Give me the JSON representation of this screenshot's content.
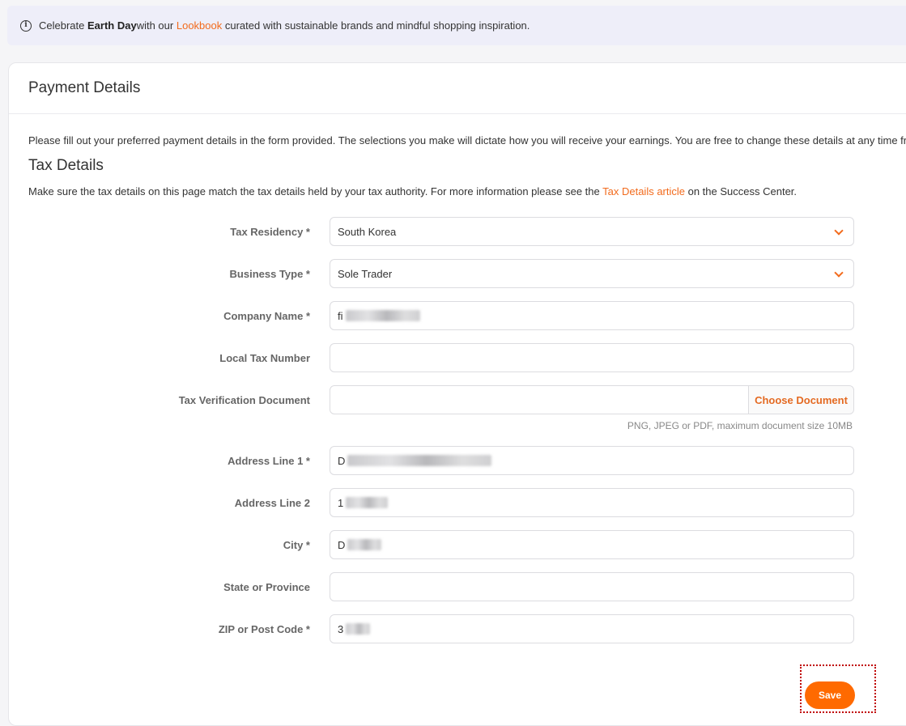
{
  "banner": {
    "text_before": "Celebrate ",
    "bold": "Earth Day",
    "text_mid": " with our ",
    "link": "Lookbook",
    "text_after": " curated with sustainable brands and mindful shopping inspiration."
  },
  "card": {
    "title": "Payment Details",
    "intro": "Please fill out your preferred payment details in the form provided. The selections you make will dictate how you will receive your earnings. You are free to change these details at any time fro"
  },
  "tax": {
    "title": "Tax Details",
    "desc_before": "Make sure the tax details on this page match the tax details held by your tax authority. For more information please see the ",
    "desc_link": "Tax Details article",
    "desc_after": " on the Success Center."
  },
  "form": {
    "tax_residency": {
      "label": "Tax Residency *",
      "value": "South Korea"
    },
    "business_type": {
      "label": "Business Type *",
      "value": "Sole Trader"
    },
    "company_name": {
      "label": "Company Name *",
      "value": "fi"
    },
    "local_tax_number": {
      "label": "Local Tax Number",
      "value": ""
    },
    "tax_document": {
      "label": "Tax Verification Document",
      "button": "Choose Document",
      "hint": "PNG, JPEG or PDF, maximum document size 10MB"
    },
    "address1": {
      "label": "Address Line 1 *",
      "value": "D"
    },
    "address2": {
      "label": "Address Line 2",
      "value": "1"
    },
    "city": {
      "label": "City *",
      "value": "D"
    },
    "state": {
      "label": "State or Province",
      "value": ""
    },
    "zip": {
      "label": "ZIP or Post Code *",
      "value": "3"
    }
  },
  "actions": {
    "save": "Save"
  },
  "colors": {
    "accent": "#ff6a00",
    "link": "#f26b1d"
  }
}
